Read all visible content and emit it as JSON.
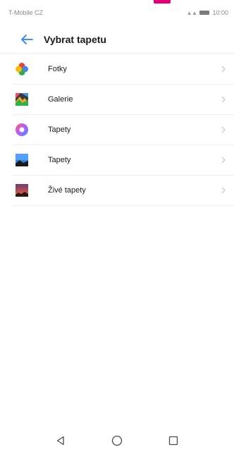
{
  "status": {
    "carrier": "T-Mobile CZ",
    "signal": "⸛,⸛",
    "time": "10:00"
  },
  "header": {
    "title": "Vybrat tapetu"
  },
  "items": [
    {
      "label": "Fotky",
      "icon": "google-photos-icon"
    },
    {
      "label": "Galerie",
      "icon": "gallery-icon"
    },
    {
      "label": "Tapety",
      "icon": "wallpapers-app-icon"
    },
    {
      "label": "Tapety",
      "icon": "wallpapers-landscape-icon"
    },
    {
      "label": "Živé tapety",
      "icon": "live-wallpaper-icon"
    }
  ],
  "colors": {
    "accent": "#007aff",
    "carrier_brand": "#e20074"
  }
}
